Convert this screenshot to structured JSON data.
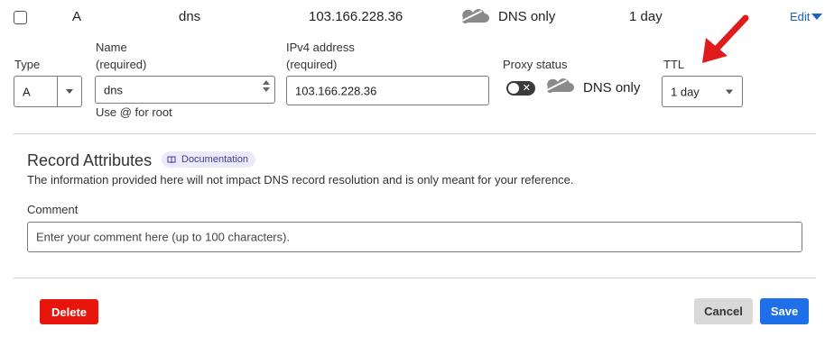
{
  "record_row": {
    "type": "A",
    "name": "dns",
    "content": "103.166.228.36",
    "proxy_status": "DNS only",
    "ttl": "1 day",
    "edit_label": "Edit"
  },
  "form": {
    "type_label": "Type",
    "type_value": "A",
    "name_label": "Name",
    "name_required": "(required)",
    "name_value": "dns",
    "name_hint": "Use @ for root",
    "ipv4_label": "IPv4 address",
    "ipv4_required": "(required)",
    "ipv4_value": "103.166.228.36",
    "proxy_label": "Proxy status",
    "proxy_value": "DNS only",
    "ttl_label": "TTL",
    "ttl_value": "1 day"
  },
  "attributes": {
    "title": "Record Attributes",
    "doc_label": "Documentation",
    "description": "The information provided here will not impact DNS record resolution and is only meant for your reference.",
    "comment_label": "Comment",
    "comment_placeholder": "Enter your comment here (up to 100 characters)."
  },
  "actions": {
    "delete_label": "Delete",
    "cancel_label": "Cancel",
    "save_label": "Save"
  },
  "icons": {
    "cloud": "cloud-icon",
    "arrow": "red-arrow-annotation",
    "book": "book-icon"
  },
  "colors": {
    "link": "#1a62c9",
    "delete": "#e8150d",
    "save": "#1f6fe8",
    "cancel": "#d9d9d9",
    "annotation_arrow": "#e01b1b"
  }
}
